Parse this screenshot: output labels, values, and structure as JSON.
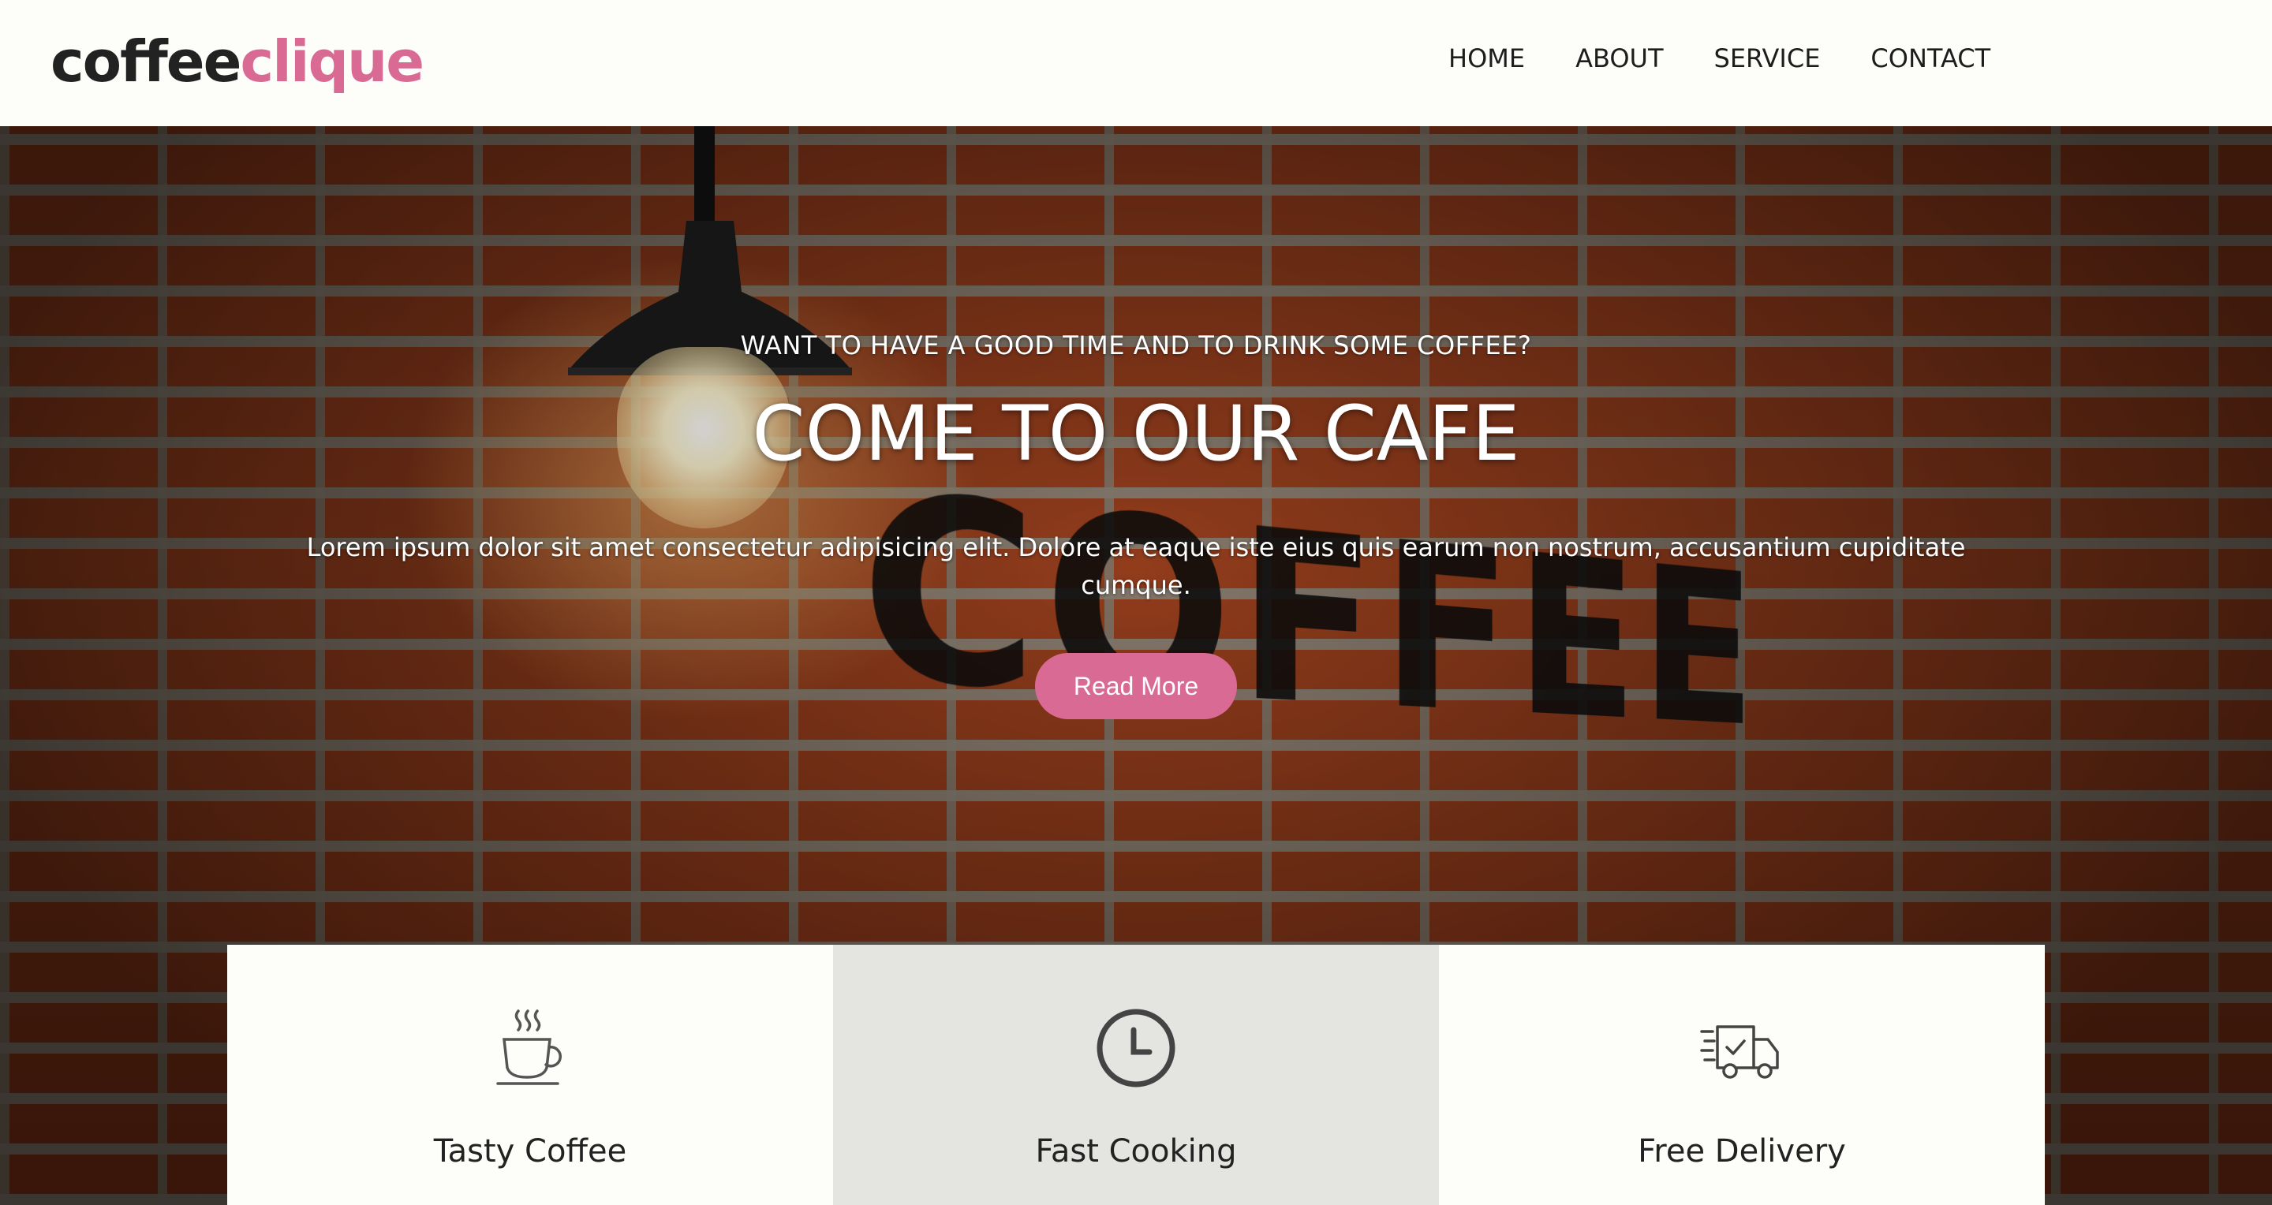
{
  "brand": {
    "logo_part1": "coffee",
    "logo_part2": "clique",
    "accent_color": "#d96a93"
  },
  "nav": {
    "items": [
      {
        "label": "HOME"
      },
      {
        "label": "ABOUT"
      },
      {
        "label": "SERVICE"
      },
      {
        "label": "CONTACT"
      }
    ]
  },
  "hero": {
    "kicker": "WANT TO HAVE A GOOD TIME AND TO DRINK SOME COFFEE?",
    "title": "COME TO OUR CAFE",
    "text": "Lorem ipsum dolor sit amet consectetur adipisicing elit. Dolore at eaque iste eius quis earum non nostrum, accusantium cupiditate cumque.",
    "button_label": "Read More",
    "wall_sign": "COFFEE"
  },
  "features": [
    {
      "title": "Tasty Coffee",
      "icon": "coffee-cup-icon"
    },
    {
      "title": "Fast Cooking",
      "icon": "clock-icon"
    },
    {
      "title": "Free Delivery",
      "icon": "delivery-truck-icon"
    }
  ]
}
